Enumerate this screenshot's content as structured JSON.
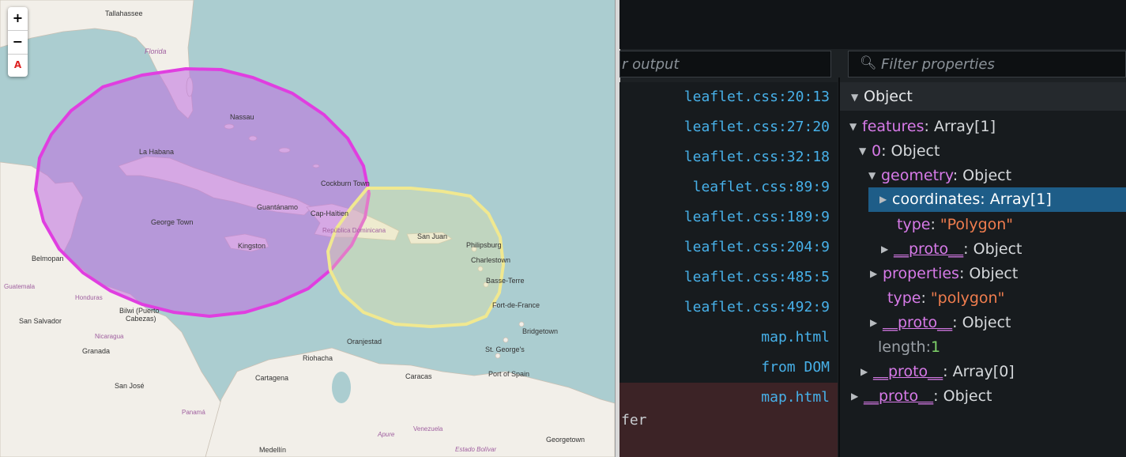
{
  "map": {
    "zoom_in": "+",
    "zoom_out": "−",
    "extra_control": "A",
    "place_labels": [
      {
        "id": "tallahassee",
        "text": "Tallahassee"
      },
      {
        "id": "florida",
        "text": "Florida"
      },
      {
        "id": "nassau",
        "text": "Nassau"
      },
      {
        "id": "la-habana",
        "text": "La Habana"
      },
      {
        "id": "cockburn-town",
        "text": "Cockburn Town"
      },
      {
        "id": "guantanamo",
        "text": "Guantánamo"
      },
      {
        "id": "cap-haitien",
        "text": "Cap-Haïtien"
      },
      {
        "id": "george-town",
        "text": "George Town"
      },
      {
        "id": "republica-dominicana",
        "text": "República Dominicana"
      },
      {
        "id": "san-juan",
        "text": "San Juan"
      },
      {
        "id": "philipsburg",
        "text": "Philipsburg"
      },
      {
        "id": "charlestown",
        "text": "Charlestown"
      },
      {
        "id": "kingston",
        "text": "Kingston"
      },
      {
        "id": "belmopan",
        "text": "Belmopan"
      },
      {
        "id": "basse-terre",
        "text": "Basse-Terre"
      },
      {
        "id": "guatemala",
        "text": "Guatemala"
      },
      {
        "id": "honduras",
        "text": "Honduras"
      },
      {
        "id": "fort-de-france",
        "text": "Fort-de-France"
      },
      {
        "id": "san-salvador",
        "text": "San Salvador"
      },
      {
        "id": "bilwi",
        "text": "Bilwi (Puerto"
      },
      {
        "id": "cabezas",
        "text": "Cabezas)"
      },
      {
        "id": "bridgetown",
        "text": "Bridgetown"
      },
      {
        "id": "nicaragua",
        "text": "Nicaragua"
      },
      {
        "id": "oranjestad",
        "text": "Oranjestad"
      },
      {
        "id": "granada",
        "text": "Granada"
      },
      {
        "id": "st-georges",
        "text": "St. George's"
      },
      {
        "id": "riohacha",
        "text": "Riohacha"
      },
      {
        "id": "cartagena",
        "text": "Cartagena"
      },
      {
        "id": "caracas",
        "text": "Caracas"
      },
      {
        "id": "port-of-spain",
        "text": "Port of Spain"
      },
      {
        "id": "san-jose",
        "text": "San José"
      },
      {
        "id": "panama",
        "text": "Panamá"
      },
      {
        "id": "venezuela",
        "text": "Venezuela"
      },
      {
        "id": "apure",
        "text": "Apure"
      },
      {
        "id": "georgetown",
        "text": "Georgetown"
      },
      {
        "id": "medellin",
        "text": "Medellín"
      },
      {
        "id": "estado-bolivar",
        "text": "Estado Bolívar"
      }
    ],
    "polygons": [
      {
        "name": "magenta-polygon",
        "stroke": "#e03ee0",
        "fill": "#c06ee0"
      },
      {
        "name": "yellow-polygon",
        "stroke": "#f0e890",
        "fill": "#e8e4a0"
      }
    ]
  },
  "devtools": {
    "console_filter_placeholder": "r output",
    "properties_filter_placeholder": "Filter properties",
    "console_rows": [
      "leaflet.css:20:13",
      "leaflet.css:27:20",
      "leaflet.css:32:18",
      "leaflet.css:89:9",
      "leaflet.css:189:9",
      "leaflet.css:204:9",
      "leaflet.css:485:5",
      "leaflet.css:492:9",
      "map.html",
      "from DOM"
    ],
    "error_row": "map.html",
    "error_suffix": "fer",
    "tree": {
      "root": "Object",
      "features_key": "features",
      "features_val": "Array[1]",
      "item0_key": "0",
      "item0_val": "Object",
      "geometry_key": "geometry",
      "geometry_val": "Object",
      "coordinates_key": "coordinates",
      "coordinates_val": "Array[1]",
      "geom_type_key": "type",
      "geom_type_val": "\"Polygon\"",
      "geom_proto_key": "__proto__",
      "geom_proto_val": "Object",
      "properties_key": "properties",
      "properties_val": "Object",
      "feat_type_key": "type",
      "feat_type_val": "\"polygon\"",
      "feat_proto_key": "__proto__",
      "feat_proto_val": "Object",
      "length_key": "length",
      "length_val": "1",
      "arr_proto_key": "__proto__",
      "arr_proto_val": "Array[0]",
      "obj_proto_key": "__proto__",
      "obj_proto_val": "Object"
    }
  },
  "colors": {
    "sea": "#abcdd0",
    "land": "#f2efe9",
    "link_blue": "#47b0e8",
    "highlight": "#1e5d88",
    "key_purple": "#d77ae8",
    "string_orange": "#f07d4e",
    "number_green": "#7fd36a"
  }
}
